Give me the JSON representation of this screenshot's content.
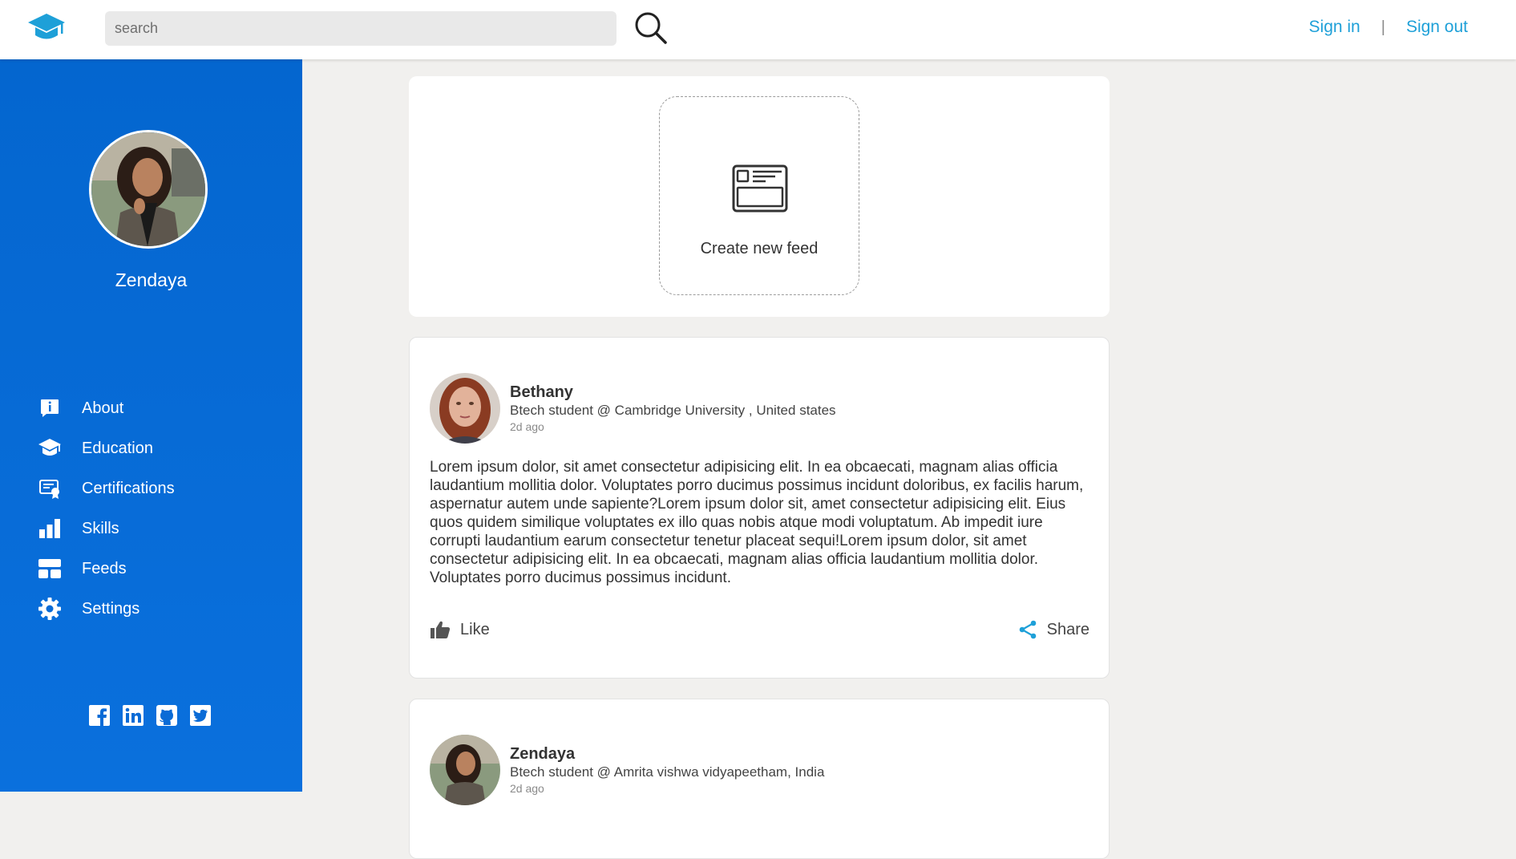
{
  "header": {
    "search_placeholder": "search",
    "sign_in": "Sign in",
    "separator": "|",
    "sign_out": "Sign out"
  },
  "profile": {
    "name": "Zendaya"
  },
  "sidebar": {
    "items": [
      {
        "label": "About",
        "icon": "info-icon"
      },
      {
        "label": "Education",
        "icon": "graduation-cap-icon"
      },
      {
        "label": "Certifications",
        "icon": "certificate-icon"
      },
      {
        "label": "Skills",
        "icon": "bar-chart-icon"
      },
      {
        "label": "Feeds",
        "icon": "feeds-layout-icon"
      },
      {
        "label": "Settings",
        "icon": "gear-icon"
      }
    ],
    "social": [
      "facebook-icon",
      "linkedin-icon",
      "github-icon",
      "twitter-icon"
    ]
  },
  "create": {
    "label": "Create new feed"
  },
  "posts": [
    {
      "name": "Bethany",
      "subtitle": "Btech student @ Cambridge University , United states",
      "time": "2d ago",
      "body": "Lorem ipsum dolor, sit amet consectetur adipisicing elit. In ea obcaecati, magnam alias officia laudantium mollitia dolor. Voluptates porro ducimus possimus incidunt doloribus, ex facilis harum, aspernatur autem unde sapiente?Lorem ipsum dolor sit, amet consectetur adipisicing elit. Eius quos quidem similique voluptates ex illo quas nobis atque modi voluptatum. Ab impedit iure corrupti laudantium earum consectetur tenetur placeat sequi!Lorem ipsum dolor, sit amet consectetur adipisicing elit. In ea obcaecati, magnam alias officia laudantium mollitia dolor. Voluptates porro ducimus possimus incidunt.",
      "like_label": "Like",
      "share_label": "Share"
    },
    {
      "name": "Zendaya",
      "subtitle": "Btech student @ Amrita vishwa vidyapeetham, India",
      "time": "2d ago"
    }
  ],
  "colors": {
    "sidebar": "#0466cf",
    "accent": "#1ea0d8",
    "page_bg": "#f1f0ee"
  }
}
